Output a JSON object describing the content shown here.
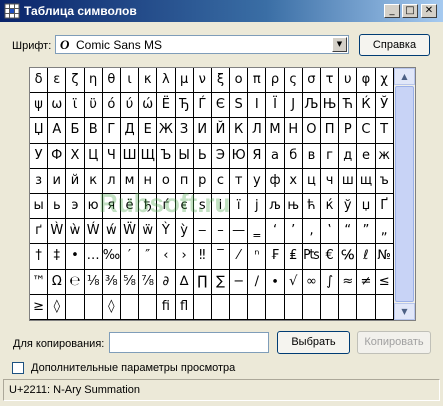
{
  "window": {
    "title": "Таблица символов",
    "controls": {
      "minimize": "_",
      "maximize": "□",
      "close": "✕"
    }
  },
  "font": {
    "label": "Шрифт:",
    "icon_glyph": "O",
    "value": "Comic Sans MS",
    "arrow": "▼",
    "help_label": "Справка"
  },
  "grid": {
    "rows": [
      [
        "δ",
        "ε",
        "ζ",
        "η",
        "θ",
        "ι",
        "κ",
        "λ",
        "μ",
        "ν",
        "ξ",
        "ο",
        "π",
        "ρ",
        "ς",
        "σ",
        "τ",
        "υ",
        "φ",
        "χ"
      ],
      [
        "ψ",
        "ω",
        "ϊ",
        "ϋ",
        "ό",
        "ύ",
        "ώ",
        "Ё",
        "Ђ",
        "Ѓ",
        "Є",
        "Ѕ",
        "І",
        "Ї",
        "Ј",
        "Љ",
        "Њ",
        "Ћ",
        "Ќ",
        "Ў"
      ],
      [
        "Џ",
        "А",
        "Б",
        "В",
        "Г",
        "Д",
        "Е",
        "Ж",
        "З",
        "И",
        "Й",
        "К",
        "Л",
        "М",
        "Н",
        "О",
        "П",
        "Р",
        "С",
        "Т"
      ],
      [
        "У",
        "Ф",
        "Х",
        "Ц",
        "Ч",
        "Ш",
        "Щ",
        "Ъ",
        "Ы",
        "Ь",
        "Э",
        "Ю",
        "Я",
        "а",
        "б",
        "в",
        "г",
        "д",
        "е",
        "ж"
      ],
      [
        "з",
        "и",
        "й",
        "к",
        "л",
        "м",
        "н",
        "о",
        "п",
        "р",
        "с",
        "т",
        "у",
        "ф",
        "х",
        "ц",
        "ч",
        "ш",
        "щ",
        "ъ"
      ],
      [
        "ы",
        "ь",
        "э",
        "ю",
        "я",
        "ё",
        "ђ",
        "ѓ",
        "є",
        "ѕ",
        "і",
        "ї",
        "ј",
        "љ",
        "њ",
        "ћ",
        "ќ",
        "ў",
        "џ",
        "Ґ"
      ],
      [
        "ґ",
        "Ẁ",
        "ẁ",
        "Ẃ",
        "ẃ",
        "Ẅ",
        "ẅ",
        "Ỳ",
        "ỳ",
        "‒",
        "–",
        "—",
        "‗",
        "‘",
        "’",
        "‚",
        "‛",
        "“",
        "”",
        "„"
      ],
      [
        "†",
        "‡",
        "•",
        "…",
        "‰",
        "′",
        "″",
        "‹",
        "›",
        "‼",
        "‾",
        "⁄",
        "ⁿ",
        "₣",
        "₤",
        "₧",
        "€",
        "℅",
        "ℓ",
        "№"
      ],
      [
        "™",
        "Ω",
        "℮",
        "⅛",
        "⅜",
        "⅝",
        "⅞",
        "∂",
        "∆",
        "∏",
        "∑",
        "−",
        "∕",
        "∙",
        "√",
        "∞",
        "∫",
        "≈",
        "≠",
        "≤"
      ],
      [
        "≥",
        "◊",
        "",
        "",
        "◊",
        "",
        "",
        "ﬁ",
        "ﬂ",
        "",
        "",
        "",
        "",
        "",
        "",
        "",
        "",
        "",
        "",
        ""
      ]
    ],
    "scroll_up": "▲",
    "scroll_down": "▼"
  },
  "zoom": {
    "glyph": "∑"
  },
  "watermark": {
    "text": "Rubsoft.ru"
  },
  "copy": {
    "label": "Для копирования:",
    "value": "",
    "select_label": "Выбрать",
    "copy_label": "Копировать"
  },
  "advanced": {
    "label": "Дополнительные параметры просмотра",
    "checked": false
  },
  "status": {
    "text": "U+2211: N-Ary Summation"
  }
}
